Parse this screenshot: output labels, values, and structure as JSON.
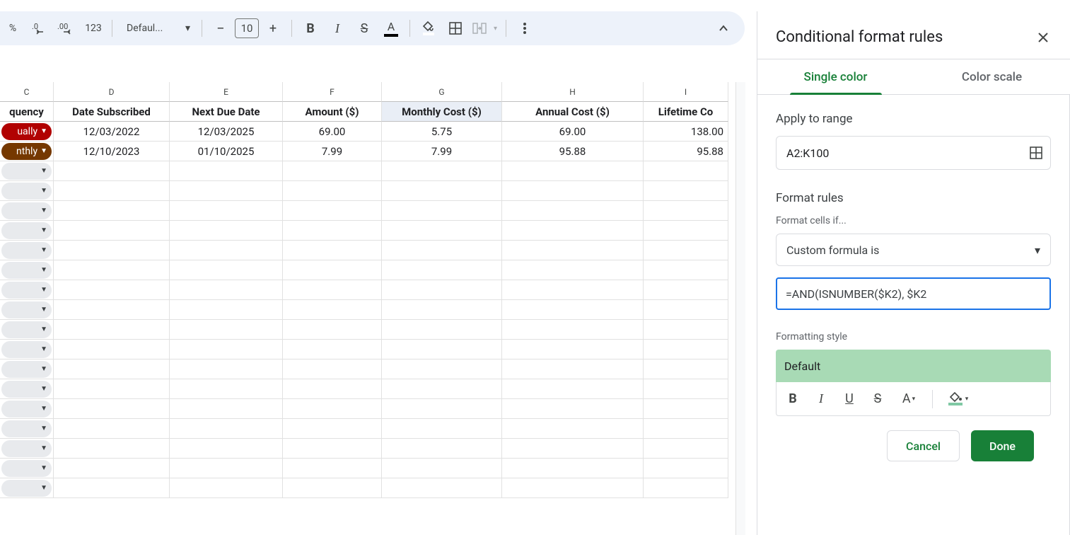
{
  "toolbar": {
    "percent": "%",
    "dec_dec": ".0",
    "dec_inc": ".00",
    "num_fmt": "123",
    "font_name": "Defaul...",
    "minus": "−",
    "font_size": "10",
    "plus": "+"
  },
  "sheet": {
    "cols": [
      "C",
      "D",
      "E",
      "F",
      "G",
      "H",
      "I"
    ],
    "header_row": [
      "quency",
      "Date Subscribed",
      "Next Due Date",
      "Amount ($)",
      "Monthly Cost ($)",
      "Annual Cost ($)",
      "Lifetime Co"
    ],
    "rows": [
      {
        "chip": "ually",
        "chip_color": "red",
        "d": "12/03/2022",
        "e": "12/03/2025",
        "f": "69.00",
        "g": "5.75",
        "h": "69.00",
        "i": "138.00"
      },
      {
        "chip": "nthly",
        "chip_color": "brown",
        "d": "12/10/2023",
        "e": "01/10/2025",
        "f": "7.99",
        "g": "7.99",
        "h": "95.88",
        "i": "95.88"
      }
    ],
    "empty_rows": 17
  },
  "sidebar": {
    "title": "Conditional format rules",
    "tabs": {
      "single": "Single color",
      "scale": "Color scale"
    },
    "apply_label": "Apply to range",
    "range_value": "A2:K100",
    "format_rules_label": "Format rules",
    "format_cells_if_label": "Format cells if...",
    "condition_select": "Custom formula is",
    "formula_value": "=AND(ISNUMBER($K2), $K2",
    "formatting_style_label": "Formatting style",
    "style_preview": "Default",
    "cancel": "Cancel",
    "done": "Done"
  }
}
